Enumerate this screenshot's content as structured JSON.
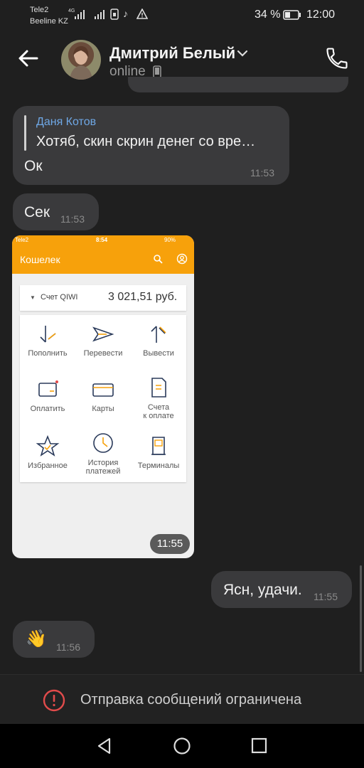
{
  "status_bar": {
    "carrier1": "Tele2",
    "carrier2": "Beeline KZ",
    "net": "4G",
    "battery": "34 %",
    "time": "12:00"
  },
  "header": {
    "name": "Дмитрий Белый",
    "presence": "online"
  },
  "messages": {
    "m1": {
      "reply_author": "Даня Котов",
      "reply_text": "Хотяб, скин скрин денег со вре…",
      "text": "Ок",
      "time": "11:53"
    },
    "m2": {
      "text": "Сек",
      "time": "11:53"
    },
    "m3": {
      "time": "11:55"
    },
    "m4": {
      "text": "Ясн, удачи.",
      "time": "11:55"
    },
    "m5": {
      "emoji": "👋",
      "time": "11:56"
    }
  },
  "qiwi": {
    "carrier": "Tele2",
    "time": "8:54",
    "battery": "90%",
    "title": "Кошелек",
    "account_label": "Счет QIWI",
    "balance": "3 021,51 руб.",
    "items": {
      "topup": "Пополнить",
      "transfer": "Перевести",
      "withdraw": "Вывести",
      "pay": "Оплатить",
      "cards": "Карты",
      "invoices_1": "Счета",
      "invoices_2": "к оплате",
      "favorites": "Избранное",
      "history_1": "История",
      "history_2": "платежей",
      "terminals": "Терминалы"
    }
  },
  "restriction": {
    "text": "Отправка сообщений ограничена"
  },
  "colors": {
    "accent": "#f7a10b",
    "bubble": "#3a3a3c",
    "reply_author": "#6fa8e6",
    "warning": "#e14b4b"
  }
}
